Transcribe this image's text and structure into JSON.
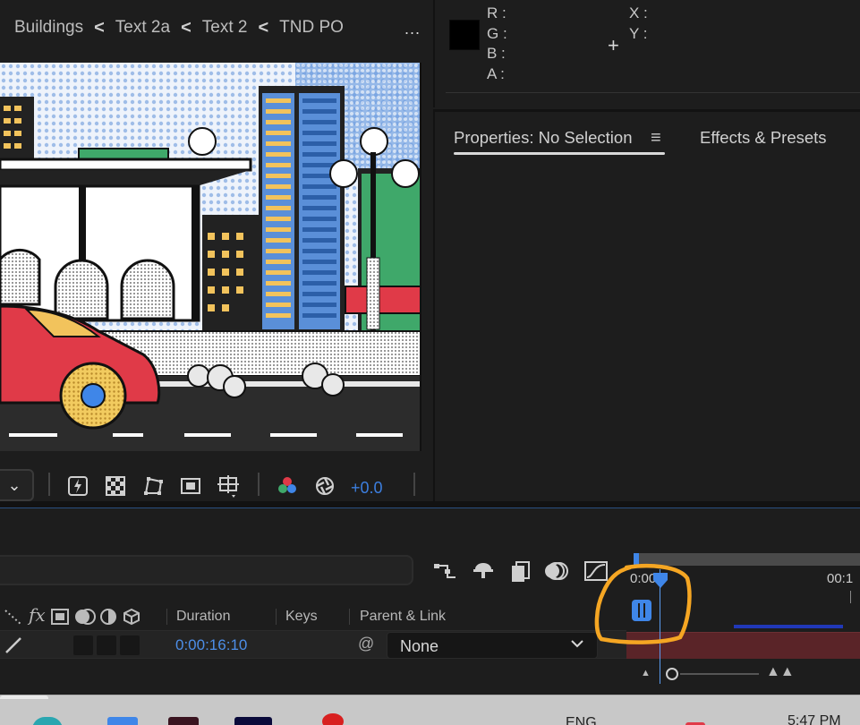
{
  "breadcrumb": {
    "items": [
      "Buildings",
      "Text 2a",
      "Text 2",
      "TND PO"
    ],
    "separator": "<",
    "more": "..."
  },
  "info": {
    "channels": [
      "R :",
      "G :",
      "B :",
      "A :"
    ],
    "coords": [
      "X :",
      "Y :"
    ],
    "swatch_color": "#000000",
    "cursor": "+"
  },
  "properties": {
    "tab_active": "Properties: No Selection",
    "menu_icon": "≡",
    "tab_other": "Effects & Presets"
  },
  "viewer_toolbar": {
    "dropdown_chevron": "⌄",
    "exposure_value": "+0.0",
    "icons": [
      "fast-previews-icon",
      "transparency-grid-icon",
      "mask-path-icon",
      "region-of-interest-icon",
      "3d-ground-plane-icon",
      "color-channels-icon",
      "reset-exposure-icon"
    ]
  },
  "timeline": {
    "columns": {
      "duration": "Duration",
      "keys": "Keys",
      "parent_link": "Parent & Link"
    },
    "switch_icons": [
      "shy-icon",
      "fx-icon",
      "frame-blending-icon",
      "motion-blur-icon",
      "adjustment-layer-icon",
      "3d-layer-icon"
    ],
    "fx_label": "fx",
    "layer": {
      "duration": "0:00:16:10",
      "parent": "None"
    },
    "ruler": {
      "start_time": "0:00",
      "next_time": "00:1"
    },
    "colors": {
      "accent": "#3f86e8",
      "layer_bar": "#5a2428",
      "annotation": "#f5a623"
    }
  },
  "taskbar": {
    "lang": "ENG",
    "time": "5:47 PM"
  }
}
